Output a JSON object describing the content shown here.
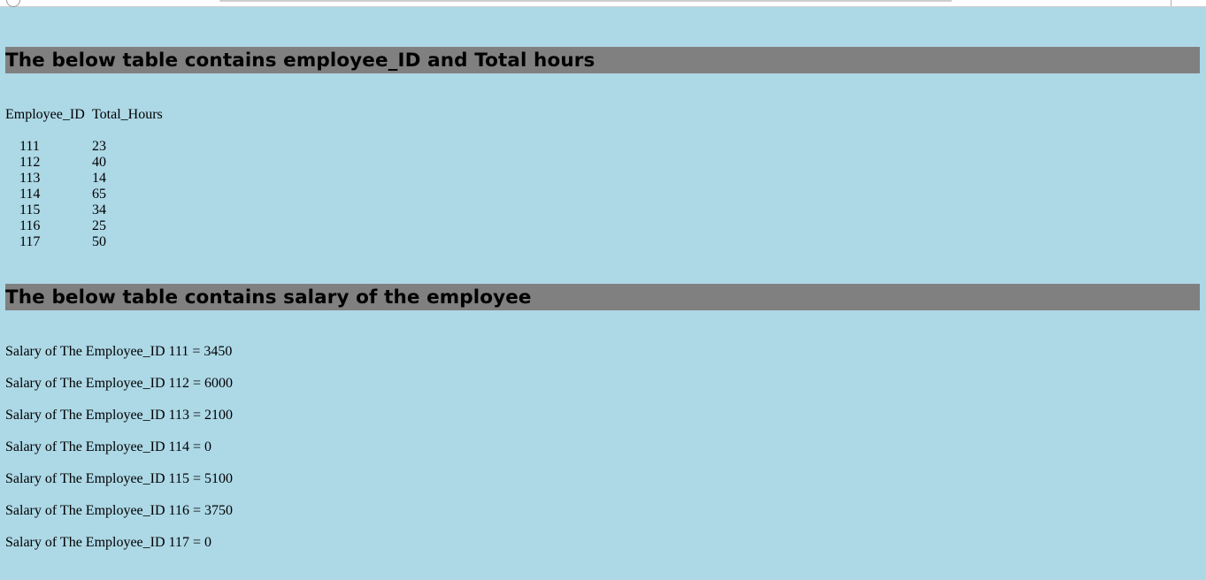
{
  "heading1": "The below table contains employee_ID and Total hours",
  "hours_table": {
    "header_id": "Employee_ID",
    "header_hours": "Total_Hours",
    "rows": [
      {
        "id": "111",
        "hours": "23"
      },
      {
        "id": "112",
        "hours": "40"
      },
      {
        "id": "113",
        "hours": "14"
      },
      {
        "id": "114",
        "hours": "65"
      },
      {
        "id": "115",
        "hours": "34"
      },
      {
        "id": "116",
        "hours": "25"
      },
      {
        "id": "117",
        "hours": "50"
      }
    ]
  },
  "heading2": "The below table contains salary of the employee",
  "salaries": [
    "Salary of The Employee_ID 111 = 3450",
    "Salary of The Employee_ID 112 = 6000",
    "Salary of The Employee_ID 113 = 2100",
    "Salary of The Employee_ID 114 = 0",
    "Salary of The Employee_ID 115 = 5100",
    "Salary of The Employee_ID 116 = 3750",
    "Salary of The Employee_ID 117 = 0"
  ],
  "colors": {
    "page_background": "#add8e6",
    "heading_background": "#808080"
  }
}
